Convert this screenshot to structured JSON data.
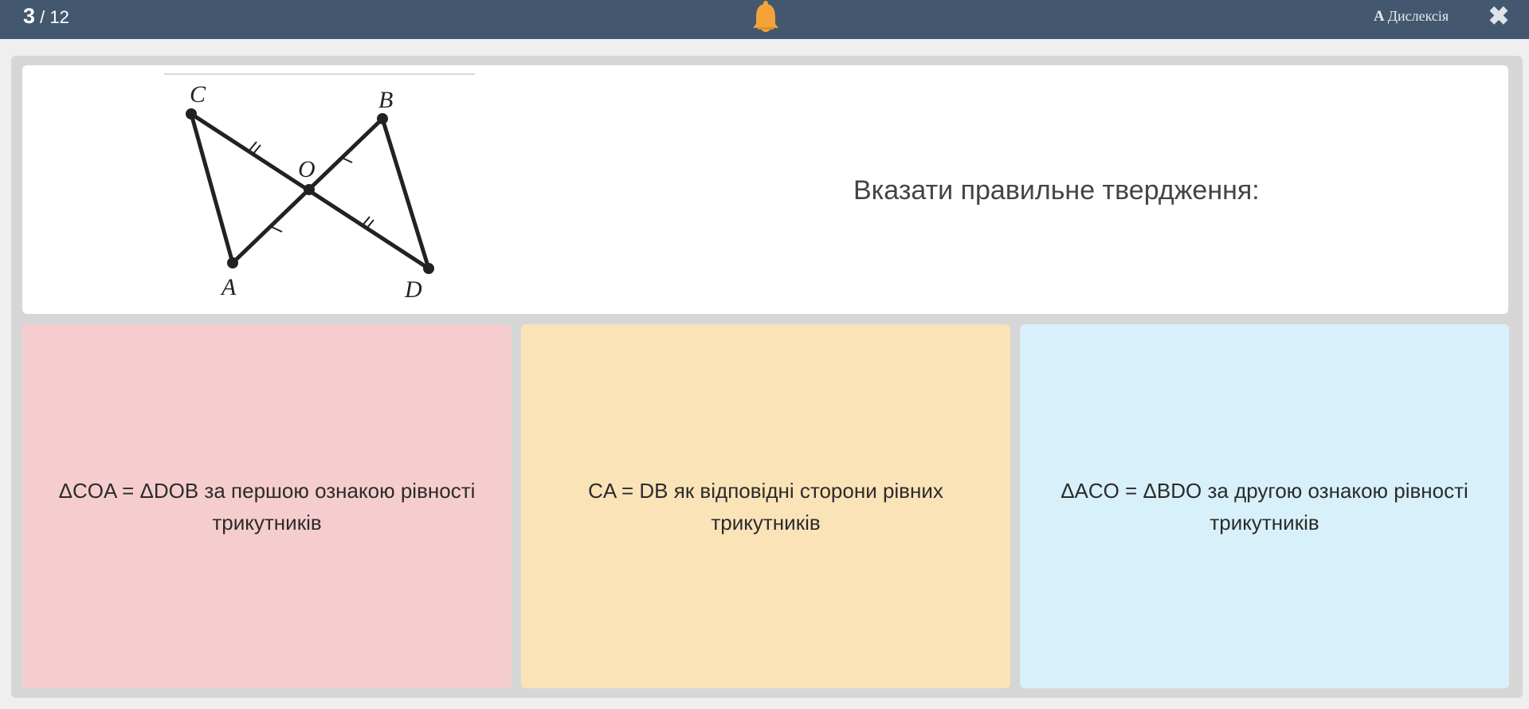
{
  "header": {
    "progress_current": "3",
    "progress_total": "/ 12",
    "bell_icon": "bell-icon",
    "dyslexia_icon_letter": "A",
    "dyslexia_label": "Дислексія",
    "close_icon": "close-icon"
  },
  "question": {
    "text": "Вказати правильне твердження:",
    "figure": {
      "points": {
        "C": "C",
        "B": "B",
        "O": "O",
        "A": "A",
        "D": "D"
      }
    }
  },
  "answers": [
    {
      "text": "ΔCOA = ΔDOB за першою ознакою рівності трикутників",
      "color": "#f6cdce"
    },
    {
      "text": "CA = DB як відповідні сторони рівних трикутників",
      "color": "#fbe3b8"
    },
    {
      "text": "ΔACO = ΔBDO за другою ознакою рівності трикутників",
      "color": "#d8f0fa"
    }
  ],
  "colors": {
    "topbar": "#43586e",
    "bell": "#f4a23a",
    "background": "#efefef"
  }
}
